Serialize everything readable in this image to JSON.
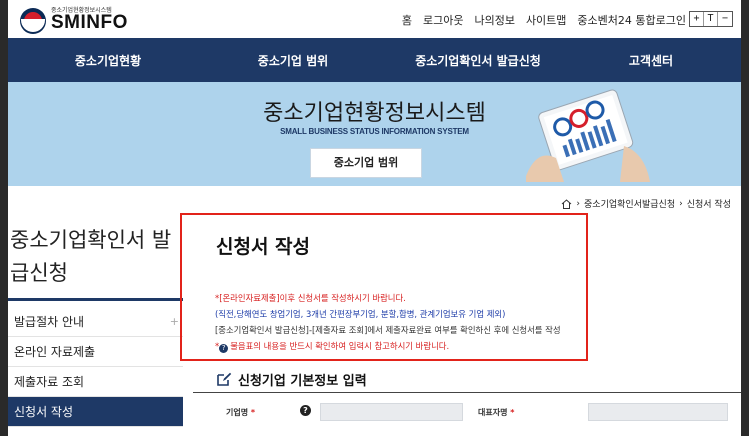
{
  "logo": {
    "tagline": "중소기업현황정보시스템",
    "name": "SMINFO"
  },
  "utility_links": [
    "홈",
    "로그아웃",
    "나의정보",
    "사이트맵",
    "중소벤처24 통합로그인"
  ],
  "zoom_controls": [
    "+",
    "T",
    "−"
  ],
  "nav": [
    "중소기업현황",
    "중소기업 범위",
    "중소기업확인서 발급신청",
    "고객센터"
  ],
  "banner": {
    "title": "중소기업현황정보시스템",
    "subtitle": "SMALL BUSINESS STATUS INFORMATION SYSTEM",
    "button": "중소기업 범위"
  },
  "breadcrumb": [
    "중소기업확인서발급신청",
    "신청서 작성"
  ],
  "sidebar": {
    "title": "중소기업확인서 발급신청",
    "items": [
      {
        "label": "발급절차 안내",
        "expand": "+"
      },
      {
        "label": "온라인 자료제출"
      },
      {
        "label": "제출자료 조회"
      },
      {
        "label": "신청서 작성"
      }
    ]
  },
  "main": {
    "title": "신청서 작성",
    "notice": {
      "line1": "*[온라인자료제출]이후 신청서를 작성하시기 바랍니다.",
      "line2": "(직전,당해연도 창업기업, 3개년 간편장부기업, 분할,합병, 관계기업보유 기업 제외)",
      "line3": "[중소기업확인서 발급신청]-[제출자료 조회]에서 제출자료완료 여부를 확인하신 후에 신청서를 작성",
      "line4_prefix": "*",
      "line4_icon": "?",
      "line4": "물음표의 내용을 반드시 확인하여 입력시 참고하시기 바랍니다."
    },
    "section_title": "신청기업 기본정보 입력",
    "form": {
      "company_label": "기업명",
      "representative_label": "대표자명",
      "required_mark": "*",
      "help": "?"
    }
  },
  "colors": {
    "navy": "#1e3966",
    "banner": "#aed3ec",
    "red": "#d71f1f",
    "highlight": "#e2231a"
  }
}
